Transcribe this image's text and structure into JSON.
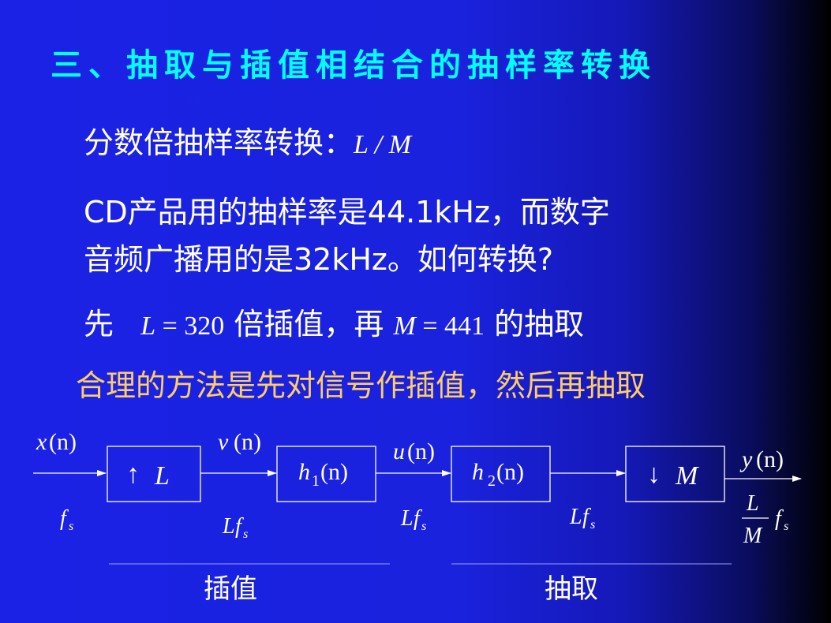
{
  "title": "三、抽取与插值相结合的抽样率转换",
  "lines": {
    "fraction_label": "分数倍抽样率转换：",
    "fraction_formula": "L / M",
    "cd_line1": "CD产品用的抽样率是44.1kHz，而数字",
    "cd_line2": "音频广播用的是32kHz。如何转换?",
    "first_prefix": "先",
    "L_var": "L",
    "L_eq": " = 320",
    "mid_text": "倍插值，再",
    "M_var": "M",
    "M_eq": " = 441",
    "end_text": "的抽取",
    "highlight": "合理的方法是先对信号作插值，然后再抽取"
  },
  "diagram": {
    "blocks": {
      "upsample": {
        "arrow": "↑",
        "var": "L"
      },
      "h1": {
        "var": "h",
        "sub": "1",
        "arg": "(n)"
      },
      "h2": {
        "var": "h",
        "sub": "2",
        "arg": "(n)"
      },
      "downsample": {
        "arrow": "↓",
        "var": "M"
      }
    },
    "signals": {
      "x": {
        "var": "x",
        "arg": "(n)"
      },
      "v": {
        "var": "v",
        "arg": "(n)"
      },
      "u": {
        "var": "u",
        "arg": "(n)"
      },
      "y": {
        "var": "y",
        "arg": "(n)"
      }
    },
    "rates": {
      "fs": {
        "main": "f",
        "sub": "s"
      },
      "Lfs1": {
        "prefix": "L",
        "main": "f",
        "sub": "s"
      },
      "Lfs2": {
        "prefix": "L",
        "main": "f",
        "sub": "s"
      },
      "Lfs3": {
        "prefix": "L",
        "main": "f",
        "sub": "s"
      },
      "out": {
        "num": "L",
        "den": "M",
        "main": "f",
        "sub": "s"
      }
    },
    "groups": {
      "interp": "插值",
      "decim": "抽取"
    }
  },
  "colors": {
    "title": "#00ffff",
    "text": "#ffffff",
    "highlight": "#ffcc66"
  }
}
